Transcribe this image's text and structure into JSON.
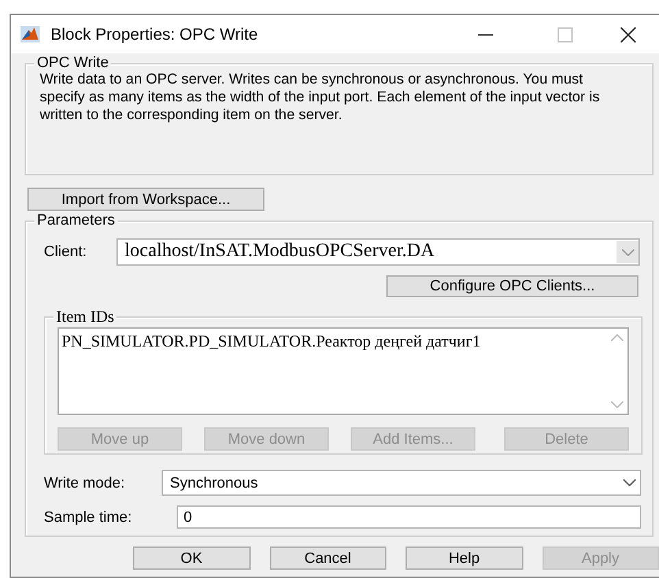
{
  "window": {
    "title": "Block Properties: OPC Write"
  },
  "description": {
    "title": "OPC Write",
    "text": "Write data to an OPC server. Writes can be synchronous or asynchronous. You must specify as many items as the width of the input port. Each element of the input vector is written to the corresponding item on the server."
  },
  "import_button": {
    "label": "Import from Workspace...",
    "disabled": false
  },
  "parameters": {
    "title": "Parameters",
    "client": {
      "label": "Client:",
      "value": "localhost/InSAT.ModbusOPCServer.DA"
    },
    "configure_button": {
      "label": "Configure OPC Clients...",
      "disabled": false
    },
    "item_ids": {
      "title": "Item IDs",
      "items": [
        {
          "text": "PN_SIMULATOR.PD_SIMULATOR.Реактор деңгей датчиг1",
          "selected": false
        }
      ],
      "buttons": [
        {
          "label": "Move up",
          "disabled": true
        },
        {
          "label": "Move down",
          "disabled": true
        },
        {
          "label": "Add Items...",
          "disabled": true
        },
        {
          "label": "Delete",
          "disabled": true
        }
      ]
    },
    "write_mode": {
      "label": "Write mode:",
      "value": "Synchronous"
    },
    "sample_time": {
      "label": "Sample time:",
      "value": "0"
    }
  },
  "buttons": [
    {
      "label": "OK",
      "disabled": false
    },
    {
      "label": "Cancel",
      "disabled": false
    },
    {
      "label": "Help",
      "disabled": false
    },
    {
      "label": "Apply",
      "disabled": true
    }
  ]
}
